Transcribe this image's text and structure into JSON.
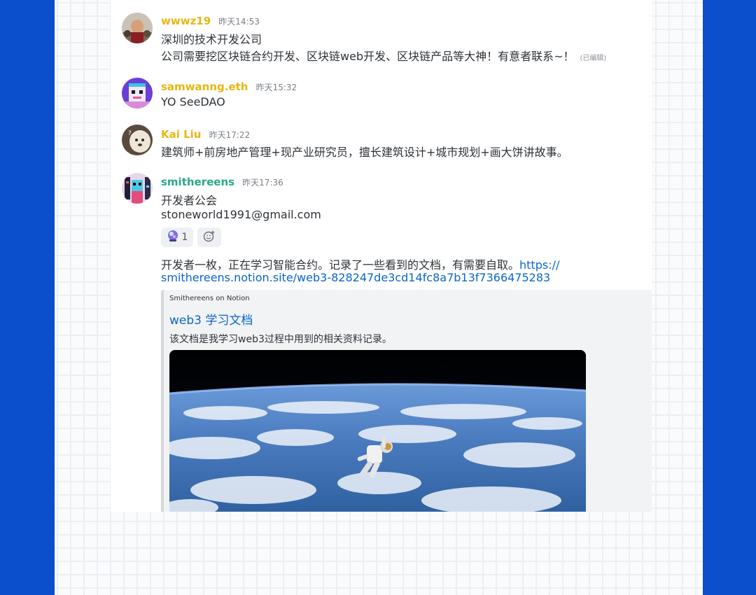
{
  "colors": {
    "background": "#0b4fcc",
    "username_gold": "#e8b614",
    "username_teal": "#2aa889",
    "link": "#0a66c9"
  },
  "messages": [
    {
      "username": "wwwz19",
      "timestamp": "昨天14:53",
      "lines": [
        "深圳的技术开发公司",
        "公司需要挖区块链合约开发、区块链web开发、区块链产品等大神！有意者联系~！"
      ],
      "edited": "(已编辑)",
      "avatar": "photo-avatar"
    },
    {
      "username": "samwanng.eth",
      "timestamp": "昨天15:32",
      "lines": [
        "YO SeeDAO"
      ],
      "avatar": "pixel-art-avatar"
    },
    {
      "username": "Kai Liu",
      "timestamp": "昨天17:22",
      "lines": [
        "建筑师+前房地产管理+现产业研究员，擅长建筑设计+城市规划+画大饼讲故事。"
      ],
      "avatar": "dog-avatar"
    },
    {
      "username": "smithereens",
      "timestamp": "昨天17:36",
      "lines": [
        "开发者公会",
        "stoneworld1991@gmail.com"
      ],
      "reaction": {
        "icon": "crystal-ball-emoji",
        "count": "1"
      },
      "add_reaction_icon": "add-reaction-icon",
      "followup": {
        "text": "开发者一枚，正在学习智能合约。记录了一些看到的文档，有需要自取。",
        "link_part1": "https://",
        "link_part2": "smithereens.notion.site/web3-828247de3cd14fc8a7b13f7366475283"
      },
      "embed": {
        "provider": "Smithereens on Notion",
        "title": "web3 学习文档",
        "description": "该文档是我学习web3过程中用到的相关资料记录。",
        "image": "astronaut-above-earth-image"
      },
      "avatar": "cyberpunk-avatar"
    }
  ]
}
